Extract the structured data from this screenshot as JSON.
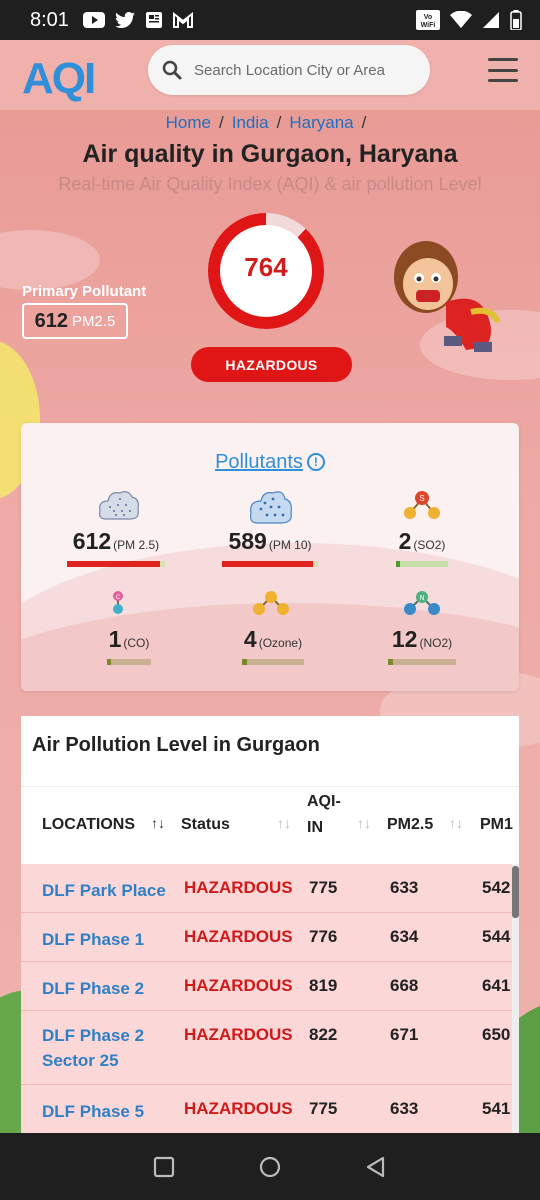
{
  "status_bar": {
    "time": "8:01"
  },
  "header": {
    "logo": "AQI",
    "search_placeholder": "Search Location City or Area"
  },
  "breadcrumb": [
    "Home",
    "India",
    "Haryana"
  ],
  "page": {
    "title": "Air quality in Gurgaon, Haryana",
    "subtitle": "Real-time Air Quality Index (AQI) & air pollution Level"
  },
  "primary_pollutant": {
    "label": "Primary Pollutant",
    "value": "612",
    "unit": "PM2.5"
  },
  "aqi": {
    "value": "764",
    "status": "HAZARDOUS",
    "color": "#e01515"
  },
  "pollutants_card": {
    "title": "Pollutants",
    "items": [
      {
        "value": "612",
        "label": "(PM 2.5)",
        "level": 0.95,
        "bar_color": "#e0231f",
        "icon": "pm25-cloud-icon"
      },
      {
        "value": "589",
        "label": "(PM 10)",
        "level": 0.95,
        "bar_color": "#e0231f",
        "icon": "pm10-cloud-icon"
      },
      {
        "value": "2",
        "label": "(SO2)",
        "level": 0.08,
        "bar_color": "#4c9a2a",
        "icon": "so2-molecule-icon"
      },
      {
        "value": "1",
        "label": "(CO)",
        "level": 0.08,
        "bar_color": "#7a8a2a",
        "icon": "co-molecule-icon"
      },
      {
        "value": "4",
        "label": "(Ozone)",
        "level": 0.08,
        "bar_color": "#7a8a2a",
        "icon": "ozone-molecule-icon"
      },
      {
        "value": "12",
        "label": "(NO2)",
        "level": 0.08,
        "bar_color": "#7a8a2a",
        "icon": "no2-molecule-icon"
      }
    ]
  },
  "table": {
    "title": "Air Pollution Level in Gurgaon",
    "columns": [
      "LOCATIONS",
      "Status",
      "AQI-IN",
      "PM2.5",
      "PM1"
    ],
    "rows": [
      {
        "location": "DLF Park Place",
        "status": "HAZARDOUS",
        "aqi": "775",
        "pm25": "633",
        "pm10": "542"
      },
      {
        "location": "DLF Phase 1",
        "status": "HAZARDOUS",
        "aqi": "776",
        "pm25": "634",
        "pm10": "544"
      },
      {
        "location": "DLF Phase 2",
        "status": "HAZARDOUS",
        "aqi": "819",
        "pm25": "668",
        "pm10": "641"
      },
      {
        "location": "DLF Phase 2 Sector 25",
        "status": "HAZARDOUS",
        "aqi": "822",
        "pm25": "671",
        "pm10": "650"
      },
      {
        "location": "DLF Phase 5",
        "status": "HAZARDOUS",
        "aqi": "775",
        "pm25": "633",
        "pm10": "541"
      }
    ]
  }
}
